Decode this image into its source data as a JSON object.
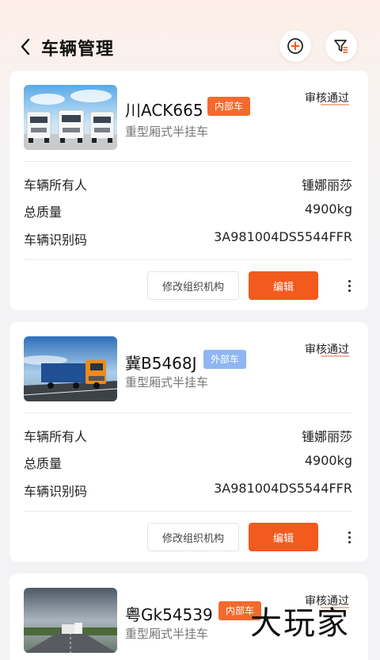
{
  "header": {
    "title": "车辆管理",
    "icons": {
      "back": "chevron-left-icon",
      "add": "plus-circle-icon",
      "filter": "filter-icon"
    }
  },
  "colors": {
    "accent": "#f25a1e",
    "internal_badge": "#f26a2e",
    "external_badge": "#8fb6f3",
    "status_underline": "#f0a082"
  },
  "labels": {
    "owner": "车辆所有人",
    "weight": "总质量",
    "vin": "车辆识别码"
  },
  "actions": {
    "modify_org": "修改组织机构",
    "edit": "编辑"
  },
  "vehicles": [
    {
      "plate": "川ACK665",
      "badge": "内部车",
      "type": "重型厢式半挂车",
      "status": "审核通过",
      "owner": "锺娜丽莎",
      "weight": "4900kg",
      "vin": "3A981004DS5544FFR",
      "image": "white-trucks-photo"
    },
    {
      "plate": "冀B5468J",
      "badge": "外部车",
      "type": "重型厢式半挂车",
      "status": "审核通过",
      "owner": "锺娜丽莎",
      "weight": "4900kg",
      "vin": "3A981004DS5544FFR",
      "image": "orange-truck-photo"
    },
    {
      "plate": "粤Gk54539",
      "badge": "内部车",
      "type": "重型厢式半挂车",
      "status": "审核通过",
      "image": "highway-truck-photo"
    }
  ],
  "watermark": "大玩家"
}
